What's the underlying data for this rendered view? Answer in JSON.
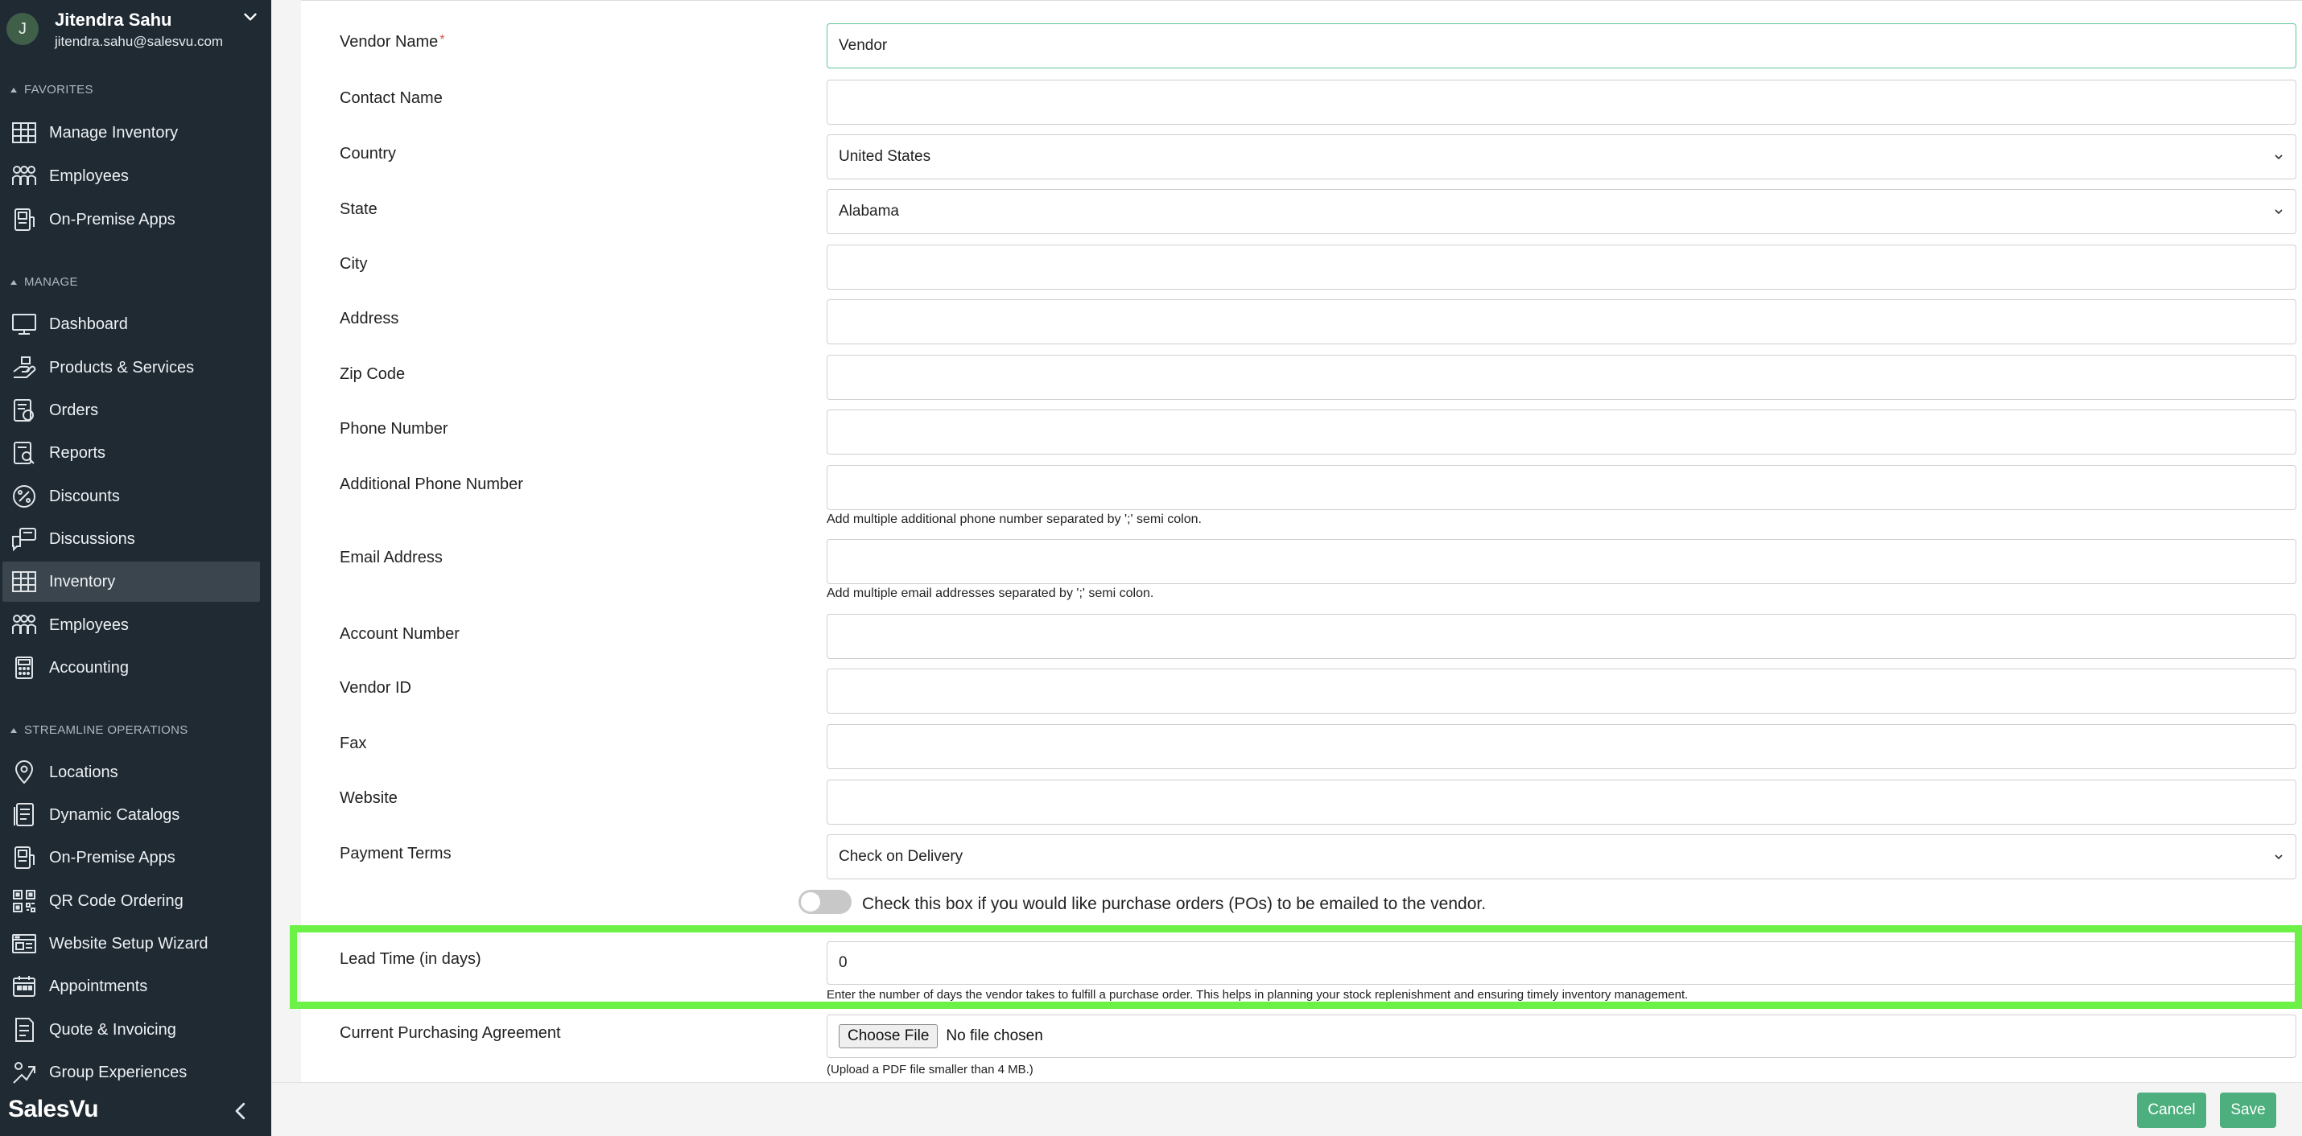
{
  "user": {
    "initial": "J",
    "name": "Jitendra Sahu",
    "email": "jitendra.sahu@salesvu.com"
  },
  "sidebar": {
    "sections": [
      {
        "title": "FAVORITES"
      },
      {
        "title": "MANAGE"
      },
      {
        "title": "STREAMLINE OPERATIONS"
      }
    ],
    "favorites": [
      {
        "label": "Manage Inventory",
        "icon": "inventory-icon"
      },
      {
        "label": "Employees",
        "icon": "employees-icon"
      },
      {
        "label": "On-Premise Apps",
        "icon": "on-premise-apps-icon"
      }
    ],
    "manage": [
      {
        "label": "Dashboard",
        "icon": "dashboard-icon"
      },
      {
        "label": "Products & Services",
        "icon": "products-icon"
      },
      {
        "label": "Orders",
        "icon": "orders-icon"
      },
      {
        "label": "Reports",
        "icon": "reports-icon"
      },
      {
        "label": "Discounts",
        "icon": "discounts-icon"
      },
      {
        "label": "Discussions",
        "icon": "discussions-icon"
      },
      {
        "label": "Inventory",
        "icon": "inventory-icon",
        "active": true
      },
      {
        "label": "Employees",
        "icon": "employees-icon"
      },
      {
        "label": "Accounting",
        "icon": "accounting-icon"
      }
    ],
    "streamline": [
      {
        "label": "Locations",
        "icon": "location-pin-icon"
      },
      {
        "label": "Dynamic Catalogs",
        "icon": "catalog-icon"
      },
      {
        "label": "On-Premise Apps",
        "icon": "on-premise-apps-icon"
      },
      {
        "label": "QR Code Ordering",
        "icon": "qr-code-icon"
      },
      {
        "label": "Website Setup Wizard",
        "icon": "website-icon"
      },
      {
        "label": "Appointments",
        "icon": "calendar-icon"
      },
      {
        "label": "Quote & Invoicing",
        "icon": "invoice-icon"
      },
      {
        "label": "Group Experiences",
        "icon": "group-experiences-icon"
      }
    ],
    "brand": "SalesVu"
  },
  "form": {
    "vendor_name": {
      "label": "Vendor Name",
      "required_mark": "*",
      "value": "Vendor"
    },
    "contact_name": {
      "label": "Contact Name",
      "value": ""
    },
    "country": {
      "label": "Country",
      "value": "United States"
    },
    "state": {
      "label": "State",
      "value": "Alabama"
    },
    "city": {
      "label": "City",
      "value": ""
    },
    "address": {
      "label": "Address",
      "value": ""
    },
    "zip": {
      "label": "Zip Code",
      "value": ""
    },
    "phone": {
      "label": "Phone Number",
      "value": ""
    },
    "additional_phone": {
      "label": "Additional Phone Number",
      "value": "",
      "help": "Add multiple additional phone number separated by ';' semi colon."
    },
    "email": {
      "label": "Email Address",
      "value": "",
      "help": "Add multiple email addresses separated by ';' semi colon."
    },
    "account_number": {
      "label": "Account Number",
      "value": ""
    },
    "vendor_id": {
      "label": "Vendor ID",
      "value": ""
    },
    "fax": {
      "label": "Fax",
      "value": ""
    },
    "website": {
      "label": "Website",
      "value": ""
    },
    "payment_terms": {
      "label": "Payment Terms",
      "value": "Check on Delivery"
    },
    "email_po_toggle": {
      "label": "Check this box if you would like purchase orders (POs) to be emailed to the vendor.",
      "checked": false
    },
    "lead_time": {
      "label": "Lead Time (in days)",
      "value": "0",
      "help": "Enter the number of days the vendor takes to fulfill a purchase order. This helps in planning your stock replenishment and ensuring timely inventory management."
    },
    "purchasing_agreement": {
      "label": "Current Purchasing Agreement",
      "button": "Choose File",
      "status": "No file chosen",
      "help": "(Upload a PDF file smaller than 4 MB.)"
    }
  },
  "footer": {
    "cancel": "Cancel",
    "save": "Save"
  },
  "colors": {
    "sidebar_bg": "#1f2a33",
    "active_item_bg": "#3b454d",
    "primary_button": "#4caf7d",
    "highlight": "#6cf146",
    "focus_border": "#5fc79a"
  }
}
